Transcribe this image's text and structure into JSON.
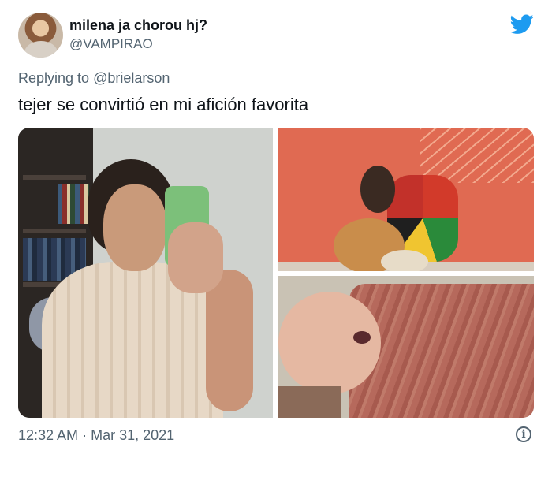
{
  "tweet": {
    "display_name": "milena ja chorou hj?",
    "username": "@VAMPIRAO",
    "reply_prefix": "Replying to",
    "reply_user": "@brielarson",
    "text": "tejer se convirtió en mi afición favorita",
    "time": "12:32 AM",
    "separator": "·",
    "date": "Mar 31, 2021",
    "media_count": 3
  },
  "icons": {
    "brand": "twitter-bird-icon",
    "info": "info-icon"
  },
  "colors": {
    "brand": "#1d9bf0",
    "secondary_text": "#536471",
    "primary_text": "#0f1419"
  }
}
